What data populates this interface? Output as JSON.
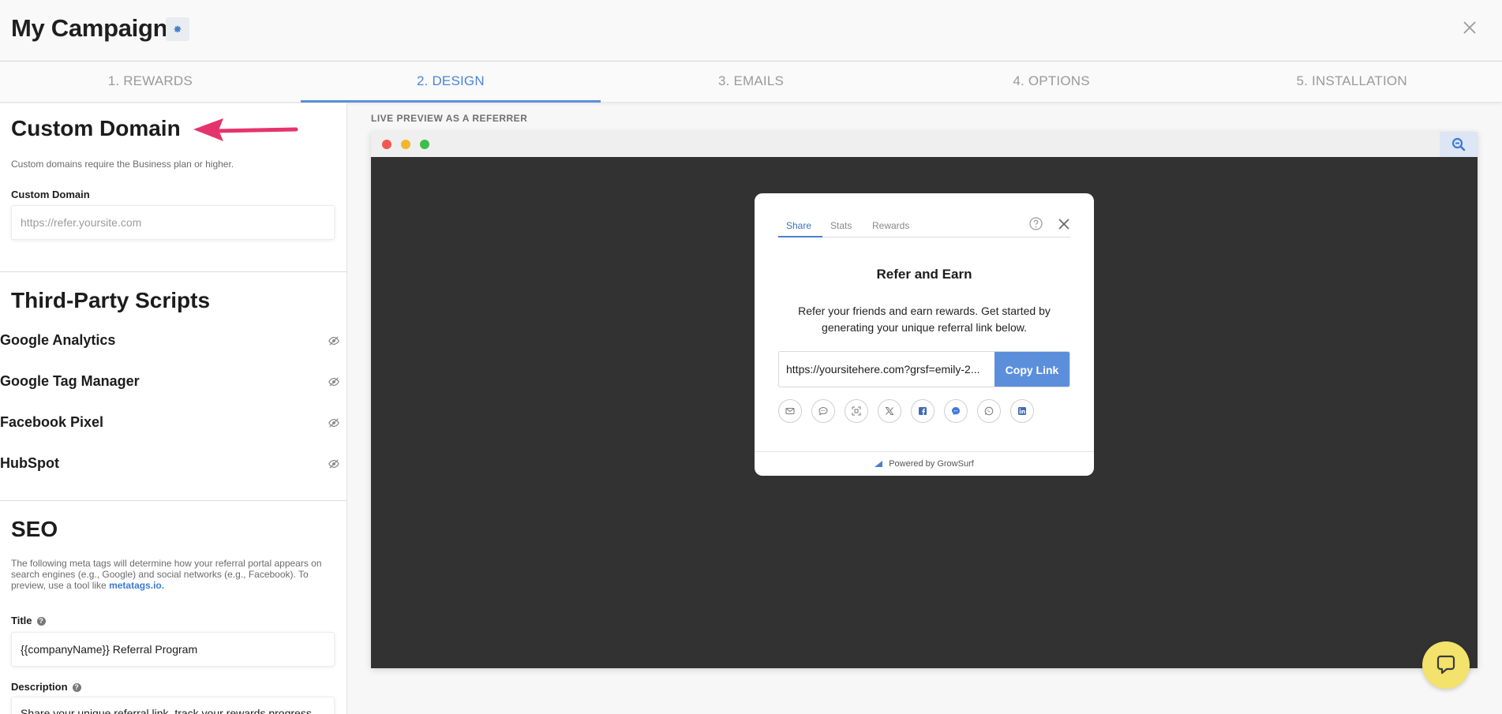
{
  "header": {
    "title": "My Campaign"
  },
  "tabs": [
    {
      "label": "1. REWARDS",
      "active": false
    },
    {
      "label": "2. DESIGN",
      "active": true
    },
    {
      "label": "3. EMAILS",
      "active": false
    },
    {
      "label": "4. OPTIONS",
      "active": false
    },
    {
      "label": "5. INSTALLATION",
      "active": false
    }
  ],
  "custom_domain": {
    "heading": "Custom Domain",
    "note": "Custom domains require the Business plan or higher.",
    "field_label": "Custom Domain",
    "placeholder": "https://refer.yoursite.com",
    "value": ""
  },
  "third_party": {
    "heading": "Third-Party Scripts",
    "items": [
      {
        "label": "Google Analytics"
      },
      {
        "label": "Google Tag Manager"
      },
      {
        "label": "Facebook Pixel"
      },
      {
        "label": "HubSpot"
      }
    ]
  },
  "seo": {
    "heading": "SEO",
    "note_prefix": "The following meta tags will determine how your referral portal appears on search engines (e.g., Google) and social networks (e.g., Facebook). To preview, use a tool like",
    "note_link": "metatags.io.",
    "title_label": "Title",
    "title_value": "{{companyName}} Referral Program",
    "description_label": "Description",
    "description_value": "Share your unique referral link, track your rewards progress,"
  },
  "preview": {
    "label": "LIVE PREVIEW AS A REFERRER",
    "modal": {
      "tabs": [
        "Share",
        "Stats",
        "Rewards"
      ],
      "active_tab": "Share",
      "title": "Refer and Earn",
      "description": "Refer your friends and earn rewards. Get started by generating your unique referral link below.",
      "link": "https://yoursitehere.com?grsf=emily-2...",
      "copy_label": "Copy Link",
      "share_icons": [
        "email-icon",
        "sms-icon",
        "qr-code-icon",
        "x-icon",
        "facebook-icon",
        "messenger-icon",
        "whatsapp-icon",
        "linkedin-icon"
      ],
      "footer": "Powered by GrowSurf"
    }
  },
  "colors": {
    "accent": "#5b8fdc",
    "chat": "#f3e26b",
    "annotation": "#e5346c"
  }
}
